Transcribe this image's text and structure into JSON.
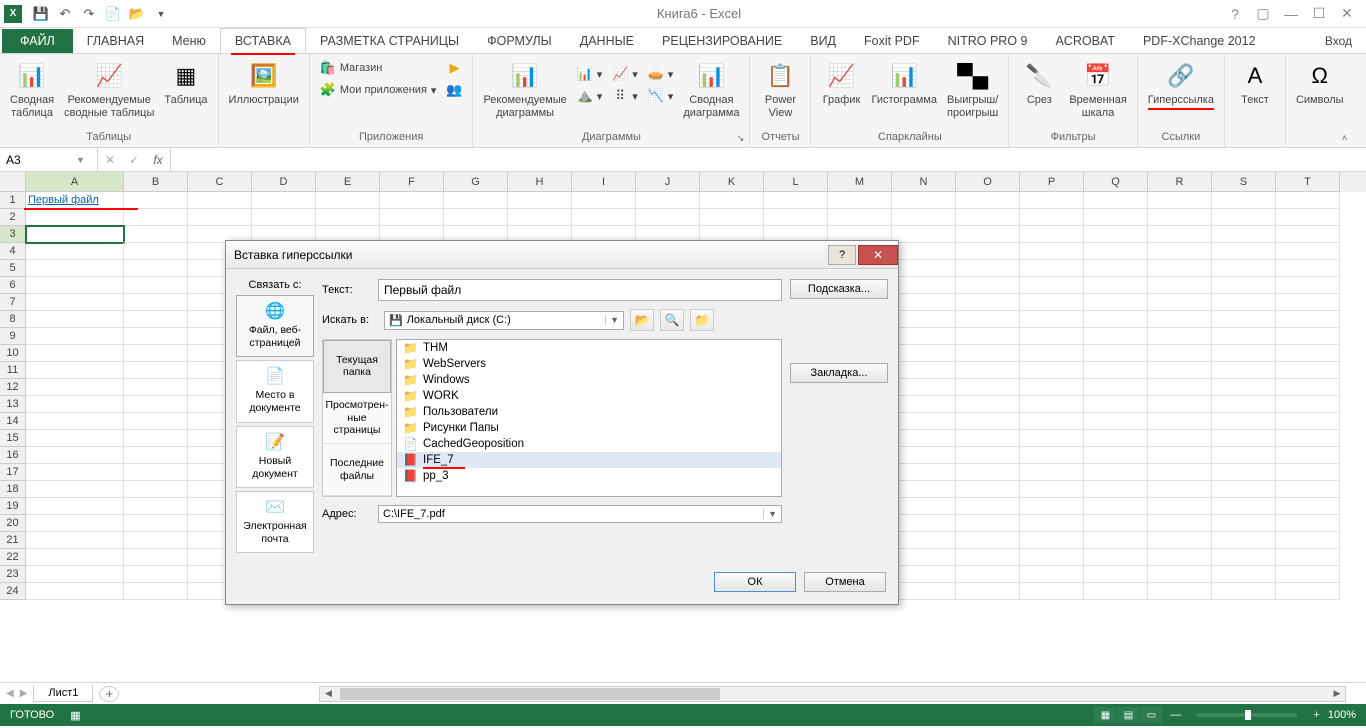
{
  "title": "Книга6 - Excel",
  "qat": [
    "save",
    "undo",
    "redo",
    "new",
    "open"
  ],
  "window": {
    "help": "?",
    "min": "▢",
    "max": "⬜",
    "restore": "🗗",
    "close": "✕"
  },
  "login": "Вход",
  "tabs": {
    "file": "ФАЙЛ",
    "home": "ГЛАВНАЯ",
    "menu": "Меню",
    "insert": "ВСТАВКА",
    "layout": "РАЗМЕТКА СТРАНИЦЫ",
    "formulas": "ФОРМУЛЫ",
    "data": "ДАННЫЕ",
    "review": "РЕЦЕНЗИРОВАНИЕ",
    "view": "ВИД",
    "foxit": "Foxit PDF",
    "nitro": "NITRO PRO 9",
    "acrobat": "ACROBAT",
    "pdfx": "PDF-XChange 2012"
  },
  "ribbon": {
    "tables": {
      "pivot": "Сводная\nтаблица",
      "recpivot": "Рекомендуемые\nсводные таблицы",
      "table": "Таблица",
      "group": "Таблицы"
    },
    "illus": {
      "label": "Иллюстрации"
    },
    "apps": {
      "store": "Магазин",
      "myapps": "Мои приложения",
      "group": "Приложения"
    },
    "charts": {
      "rec": "Рекомендуемые\nдиаграммы",
      "pivot_chart": "Сводная\nдиаграмма",
      "group": "Диаграммы"
    },
    "reports": {
      "powerview": "Power\nView",
      "group": "Отчеты"
    },
    "spark": {
      "line": "График",
      "hist": "Гистограмма",
      "winloss": "Выигрыш/\nпроигрыш",
      "group": "Спарклайны"
    },
    "filters": {
      "slicer": "Срез",
      "timeline": "Временная\nшкала",
      "group": "Фильтры"
    },
    "links": {
      "hyperlink": "Гиперссылка",
      "group": "Ссылки"
    },
    "text": {
      "text": "Текст",
      "group": ""
    },
    "symbols": {
      "symbols": "Символы",
      "group": ""
    }
  },
  "namebox": "A3",
  "columns": [
    "A",
    "B",
    "C",
    "D",
    "E",
    "F",
    "G",
    "H",
    "I",
    "J",
    "K",
    "L",
    "M",
    "N",
    "O",
    "P",
    "Q",
    "R",
    "S",
    "T"
  ],
  "col_widths": {
    "A": 98,
    "default": 64
  },
  "rows": 24,
  "active_row": 3,
  "cells": {
    "A1": "Первый файл"
  },
  "sheet_tab": "Лист1",
  "status": {
    "ready": "ГОТОВО",
    "zoom": "100%"
  },
  "dialog": {
    "title": "Вставка гиперссылки",
    "linkto_label": "Связать с:",
    "linkto": [
      {
        "label": "Файл, веб-\nстраницей",
        "icon": "🌐"
      },
      {
        "label": "Место в\nдокументе",
        "icon": "📄"
      },
      {
        "label": "Новый\nдокумент",
        "icon": "📝"
      },
      {
        "label": "Электронная\nпочта",
        "icon": "✉️"
      }
    ],
    "text_label": "Текст:",
    "text_value": "Первый файл",
    "tip_btn": "Подсказка...",
    "lookin_label": "Искать в:",
    "lookin_value": "Локальный диск (C:)",
    "browse_tabs": [
      "Текущая\nпапка",
      "Просмотрен-\nные\nстраницы",
      "Последние\nфайлы"
    ],
    "bookmark_btn": "Закладка...",
    "files": [
      {
        "name": "THM",
        "icon": "📁"
      },
      {
        "name": "WebServers",
        "icon": "📁"
      },
      {
        "name": "Windows",
        "icon": "📁"
      },
      {
        "name": "WORK",
        "icon": "📁"
      },
      {
        "name": "Пользователи",
        "icon": "📁"
      },
      {
        "name": "Рисунки Папы",
        "icon": "📁"
      },
      {
        "name": "CachedGeoposition",
        "icon": "📄"
      },
      {
        "name": "IFE_7",
        "icon": "📕",
        "selected": true
      },
      {
        "name": "pp_3",
        "icon": "📕"
      }
    ],
    "addr_label": "Адрес:",
    "addr_value": "C:\\IFE_7.pdf",
    "ok": "ОК",
    "cancel": "Отмена"
  }
}
